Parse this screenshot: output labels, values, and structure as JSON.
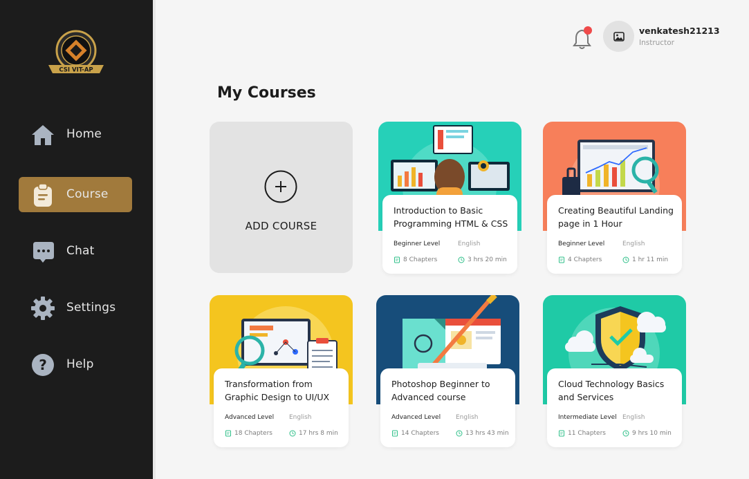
{
  "brand": {
    "logo_text": "CSI VIT-AP"
  },
  "nav": {
    "items": [
      {
        "label": "Home",
        "icon": "home-icon"
      },
      {
        "label": "Course",
        "icon": "clipboard-icon",
        "active": true
      },
      {
        "label": "Chat",
        "icon": "chat-icon"
      },
      {
        "label": "Settings",
        "icon": "gear-icon"
      },
      {
        "label": "Help",
        "icon": "help-icon"
      }
    ]
  },
  "header": {
    "notification_icon": "bell-icon",
    "notification_dot_color": "#ef4a4a",
    "user": {
      "name": "venkatesh21213",
      "role": "Instructor",
      "avatar_icon": "image-icon"
    }
  },
  "main": {
    "title": "My Courses",
    "add_course": {
      "label": "ADD COURSE",
      "icon": "plus-circle-icon"
    },
    "courses": [
      {
        "title": "Introduction to Basic Programming HTML & CSS",
        "level": "Beginner Level",
        "language": "English",
        "chapters": "8 Chapters",
        "duration": "3 hrs 20 min",
        "thumb_color": "#26d0b8"
      },
      {
        "title": "Creating Beautiful Landing page in 1 Hour",
        "level": "Beginner Level",
        "language": "English",
        "chapters": "4 Chapters",
        "duration": "1 hr 11 min",
        "thumb_color": "#f77f5a"
      },
      {
        "title": "Transformation from Graphic Design to UI/UX",
        "level": "Advanced Level",
        "language": "English",
        "chapters": "18 Chapters",
        "duration": "17 hrs 8 min",
        "thumb_color": "#f4c51f"
      },
      {
        "title": "Photoshop Beginner to Advanced course",
        "level": "Advanced Level",
        "language": "English",
        "chapters": "14  Chapters",
        "duration": "13 hrs 43 min",
        "thumb_color": "#174d7a"
      },
      {
        "title": "Cloud Technology Basics and Services",
        "level": "Intermediate Level",
        "language": "English",
        "chapters": "11 Chapters",
        "duration": "9 hrs 10 min",
        "thumb_color": "#1fcaa6"
      }
    ]
  },
  "colors": {
    "sidebar_bg": "#1c1c1c",
    "active_nav": "#a17a3c",
    "accent_green": "#2dbf88"
  }
}
